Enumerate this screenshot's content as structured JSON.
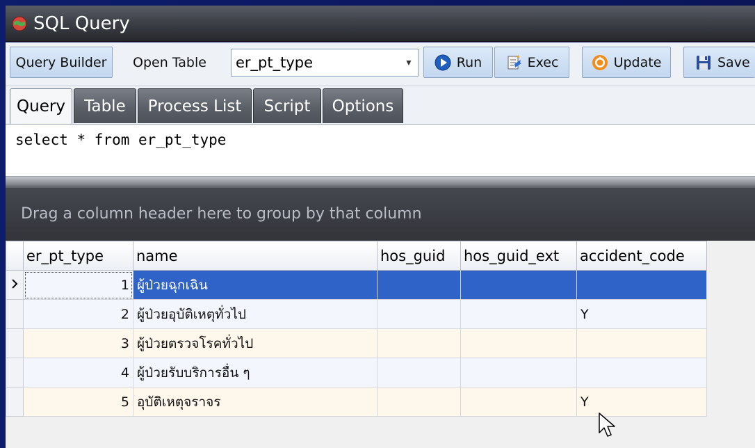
{
  "window": {
    "title": "SQL Query",
    "app_icon": "app-globe-icon"
  },
  "toolbar": {
    "query_builder_label": "Query Builder",
    "open_table_label": "Open Table",
    "table_select_value": "er_pt_type",
    "run_label": "Run",
    "exec_label": "Exec",
    "update_label": "Update",
    "save_label": "Save"
  },
  "tabs": [
    {
      "label": "Query",
      "active": true
    },
    {
      "label": "Table",
      "active": false
    },
    {
      "label": "Process List",
      "active": false
    },
    {
      "label": "Script",
      "active": false
    },
    {
      "label": "Options",
      "active": false
    }
  ],
  "editor": {
    "sql": "select * from er_pt_type"
  },
  "grid": {
    "group_panel_text": "Drag a column header here to group by that column",
    "columns": [
      "er_pt_type",
      "name",
      "hos_guid",
      "hos_guid_ext",
      "accident_code"
    ],
    "rows": [
      {
        "er_pt_type": "1",
        "name": "ผู้ป่วยฉุกเฉิน",
        "hos_guid": "",
        "hos_guid_ext": "",
        "accident_code": "",
        "selected": true
      },
      {
        "er_pt_type": "2",
        "name": "ผู้ป่วยอุบัติเหตุทั่วไป",
        "hos_guid": "",
        "hos_guid_ext": "",
        "accident_code": "Y",
        "selected": false
      },
      {
        "er_pt_type": "3",
        "name": "ผู้ป่วยตรวจโรคทั่วไป",
        "hos_guid": "",
        "hos_guid_ext": "",
        "accident_code": "",
        "selected": false
      },
      {
        "er_pt_type": "4",
        "name": "ผู้ป่วยรับบริการอื่น ๆ",
        "hos_guid": "",
        "hos_guid_ext": "",
        "accident_code": "",
        "selected": false
      },
      {
        "er_pt_type": "5",
        "name": "อุบัติเหตุจราจร",
        "hos_guid": "",
        "hos_guid_ext": "",
        "accident_code": "Y",
        "selected": false
      }
    ],
    "current_row_indicator": "row-indicator-arrow-icon"
  },
  "colors": {
    "selection": "#2f63c8",
    "row_odd": "#f4f6fd",
    "row_even": "#fef7ec",
    "tab_inactive": "#5b5f67"
  }
}
